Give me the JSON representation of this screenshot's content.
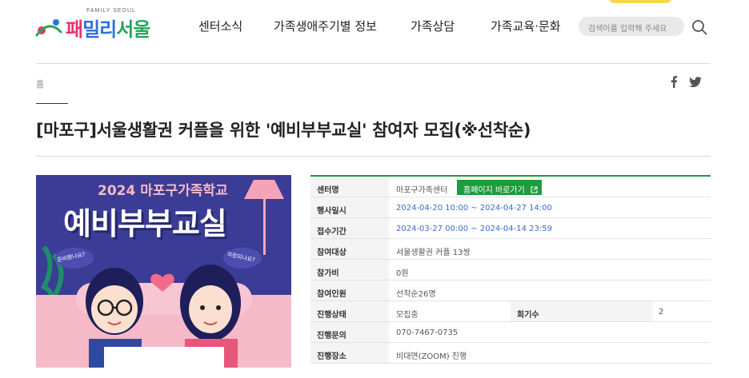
{
  "header": {
    "logo_sub": "FAMILY SEOUL",
    "logo_text_1": "패",
    "logo_text_2": "밀리",
    "logo_text_3": "서울",
    "nav": [
      "센터소식",
      "가족생애주기별 정보",
      "가족상담",
      "가족교육·문화"
    ],
    "search_placeholder": "검색어를 입력해 주세요"
  },
  "breadcrumb": {
    "home": "홈"
  },
  "page_title": "[마포구]서울생활권 커플을 위한 '예비부부교실' 참여자 모집(※선착순)",
  "poster": {
    "headline": "2024 마포구가족학교",
    "main": "예비부부교실",
    "bubble_left": "준비됐나요?",
    "bubble_right": "걱정되나요?"
  },
  "info": {
    "center_label": "센터명",
    "center_value": "마포구가족센터",
    "homepage_button": "홈페이지 바로가기",
    "date_label": "행사일시",
    "date_value": "2024-04-20 10:00 ~ 2024-04-27 14:00",
    "reg_label": "접수기간",
    "reg_value": "2024-03-27 00:00 ~ 2024-04-14 23:59",
    "target_label": "참여대상",
    "target_value": "서울생활권 커플 13쌍",
    "fee_label": "참가비",
    "fee_value": "0원",
    "capacity_label": "참여인원",
    "capacity_value": "선착순26명",
    "status_label": "진행상태",
    "status_value": "모집중",
    "sessions_label": "회기수",
    "sessions_value": "2",
    "contact_label": "진행문의",
    "contact_value": "070-7467-0735",
    "place_label": "진행장소",
    "place_value": "비대면(ZOOM) 진행"
  },
  "colors": {
    "accent_green": "#1f9a3c",
    "link_blue": "#3b6bc9",
    "poster_bg": "#3b3c95",
    "poster_headline": "#f5b9c8"
  },
  "icons": {
    "search": "search-icon",
    "facebook": "facebook-icon",
    "twitter": "twitter-icon",
    "external": "external-link-icon"
  }
}
